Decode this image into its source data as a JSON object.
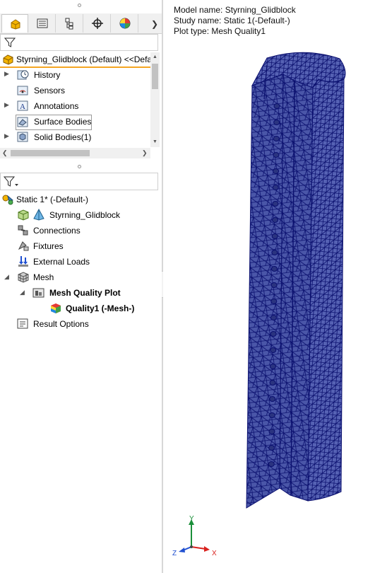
{
  "panel_tabs": [
    {
      "name": "FeatureManager",
      "icon": "feature-manager-icon"
    },
    {
      "name": "PropertyManager",
      "icon": "property-manager-icon"
    },
    {
      "name": "ConfigurationManager",
      "icon": "configuration-manager-icon"
    },
    {
      "name": "DimXpertManager",
      "icon": "dimxpert-icon"
    },
    {
      "name": "DisplayManager",
      "icon": "display-manager-icon"
    }
  ],
  "feature_tree": {
    "root_label": "Styrning_Glidblock (Default) <<Defa",
    "items": [
      {
        "label": "History",
        "icon": "history-icon",
        "expandable": true
      },
      {
        "label": "Sensors",
        "icon": "sensors-icon",
        "expandable": false
      },
      {
        "label": "Annotations",
        "icon": "annotations-icon",
        "expandable": true
      },
      {
        "label": "Surface Bodies",
        "icon": "surface-bodies-icon",
        "expandable": false
      },
      {
        "label": "Solid Bodies(1)",
        "icon": "solid-bodies-icon",
        "expandable": true
      }
    ]
  },
  "study_tree": {
    "study_label": "Static 1* (-Default-)",
    "part_label": "Styrning_Glidblock",
    "connections_label": "Connections",
    "fixtures_label": "Fixtures",
    "external_loads_label": "External Loads",
    "mesh_label": "Mesh",
    "mesh_quality_plot_label": "Mesh Quality Plot",
    "quality_label": "Quality1 (-Mesh-)",
    "result_options_label": "Result Options"
  },
  "model_info": {
    "model_name": "Model name: Styrning_Glidblock",
    "study_name": "Study name: Static 1(-Default-)",
    "plot_type": "Plot type: Mesh Quality1"
  },
  "triad": {
    "y": "Y",
    "z": "Z",
    "x": "X"
  },
  "colors": {
    "mesh_fill": "#4a56a8",
    "mesh_lines": "#0a0f6e",
    "root_underline": "#f5a623",
    "axis_x": "#d9231f",
    "axis_y": "#1b8f3a",
    "axis_z": "#1f4fd0"
  }
}
